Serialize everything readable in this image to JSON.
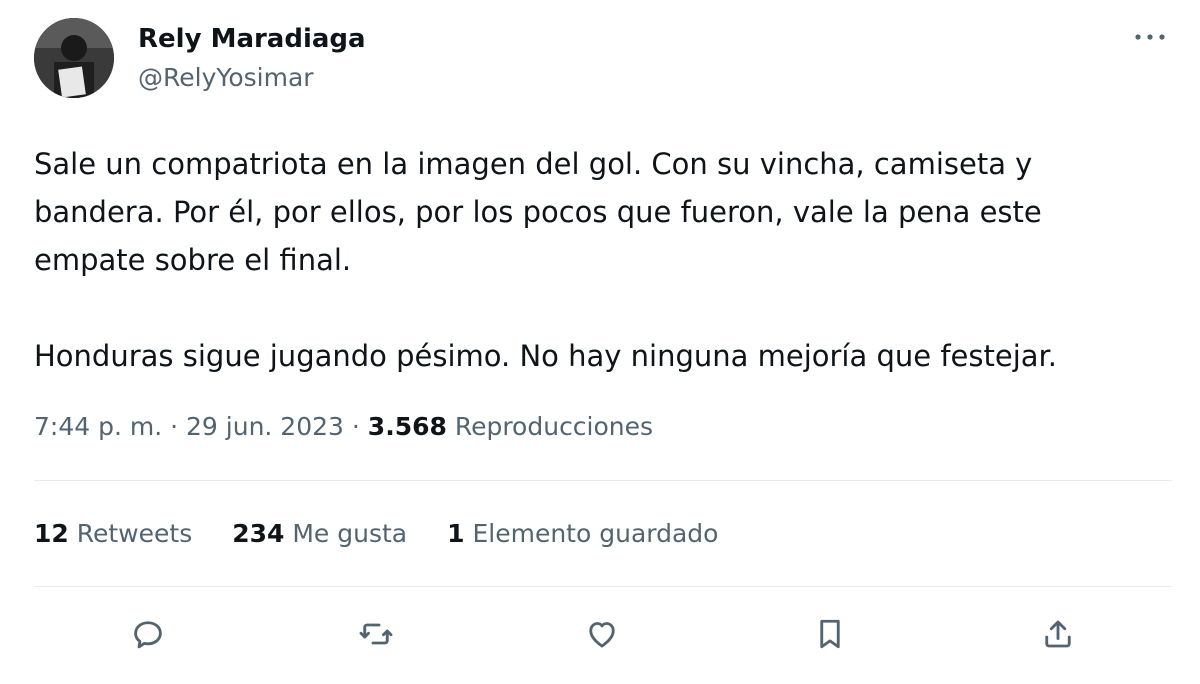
{
  "author": {
    "display_name": "Rely Maradiaga",
    "handle": "@RelyYosimar"
  },
  "tweet": {
    "text": "Sale un compatriota en la imagen del gol. Con su vincha, camiseta y\nbandera. Por él, por ellos, por los pocos que fueron, vale la pena este\nempate sobre el final.\n\nHonduras sigue jugando pésimo. No hay ninguna mejoría que festejar.",
    "time": "7:44 p. m.",
    "separator": "·",
    "date": "29 jun. 2023",
    "views_count": "3.568",
    "views_label": "Reproducciones"
  },
  "stats": {
    "retweets_count": "12",
    "retweets_label": "Retweets",
    "likes_count": "234",
    "likes_label": "Me gusta",
    "bookmarks_count": "1",
    "bookmarks_label": "Elemento guardado"
  },
  "icons": {
    "more": "more-horizontal-icon",
    "reply": "reply-icon",
    "retweet": "retweet-icon",
    "like": "heart-icon",
    "bookmark": "bookmark-icon",
    "share": "share-icon"
  },
  "colors": {
    "primary_text": "#0f1419",
    "secondary_text": "#536471",
    "divider": "#e6ecf0"
  }
}
